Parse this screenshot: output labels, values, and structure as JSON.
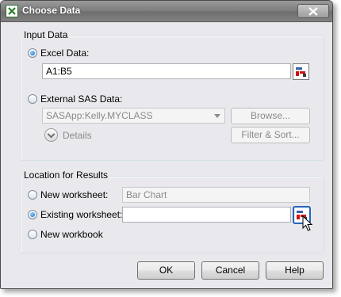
{
  "window": {
    "title": "Choose Data"
  },
  "input_data": {
    "group_label": "Input Data",
    "excel_data_label": "Excel Data:",
    "excel_data_value": "A1:B5",
    "external_sas_label": "External SAS Data:",
    "sas_source_value": "SASApp:Kelly.MYCLASS",
    "browse_label": "Browse...",
    "details_label": "Details",
    "filter_sort_label": "Filter & Sort..."
  },
  "results": {
    "group_label": "Location for Results",
    "new_worksheet_label": "New worksheet:",
    "new_worksheet_value": "Bar Chart",
    "existing_worksheet_label": "Existing worksheet:",
    "existing_worksheet_value": "",
    "new_workbook_label": "New workbook"
  },
  "buttons": {
    "ok": "OK",
    "cancel": "Cancel",
    "help": "Help"
  },
  "state": {
    "input_source": "Excel Data",
    "result_location": "Existing worksheet"
  },
  "colors": {
    "accent": "#1a6ac7",
    "picker_red": "#d01010"
  },
  "icons": [
    "excel-app-icon",
    "close-icon",
    "range-picker-icon",
    "chevron-down-icon",
    "mouse-pointer-icon"
  ]
}
